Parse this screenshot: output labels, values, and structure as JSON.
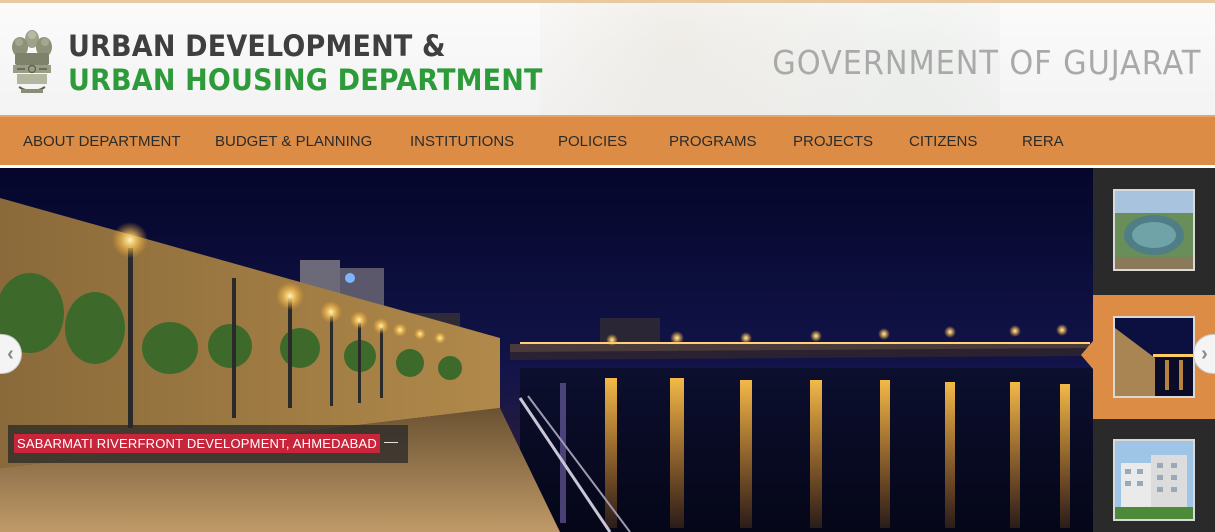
{
  "header": {
    "dept_line1": "URBAN DEVELOPMENT &",
    "dept_line2": "URBAN HOUSING DEPARTMENT",
    "gov_title": "GOVERNMENT OF GUJARAT",
    "emblem_icon": "state-emblem-icon"
  },
  "nav": {
    "items": [
      {
        "label": "ABOUT DEPARTMENT"
      },
      {
        "label": "BUDGET & PLANNING"
      },
      {
        "label": "INSTITUTIONS"
      },
      {
        "label": "POLICIES"
      },
      {
        "label": "PROGRAMS"
      },
      {
        "label": "PROJECTS"
      },
      {
        "label": "CITIZENS"
      },
      {
        "label": "RERA"
      }
    ]
  },
  "slider": {
    "caption": "SABARMATI RIVERFRONT DEVELOPMENT, AHMEDABAD",
    "caption_suffix": "—",
    "prev_icon": "chevron-left-icon",
    "next_icon": "chevron-right-icon"
  },
  "thumbnails": [
    {
      "subject": "lake-aerial",
      "active": false
    },
    {
      "subject": "riverfront-night",
      "active": true
    },
    {
      "subject": "housing-buildings",
      "active": false
    }
  ],
  "colors": {
    "nav_bg": "#dc8c45",
    "dept_green": "#2e9b3a",
    "dept_dark": "#3f3f3f",
    "gov_grey": "#a9a9a9",
    "caption_red": "#c8253a",
    "thumb_column_bg": "#2b2a2a"
  }
}
